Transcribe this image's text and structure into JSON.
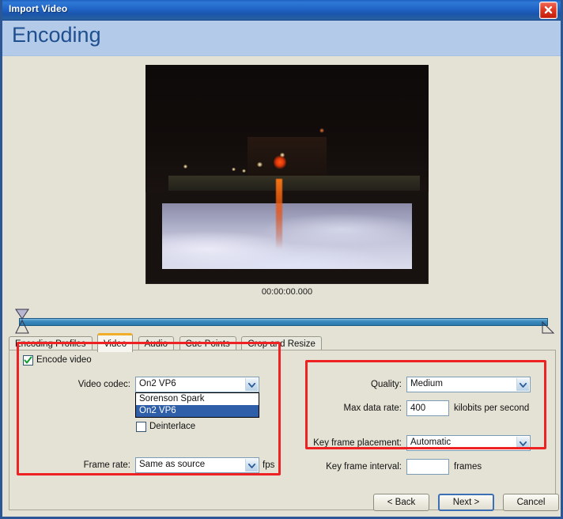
{
  "window": {
    "title": "Import Video",
    "close_icon": "close-x-icon",
    "page_title": "Encoding",
    "accent_blue": "#2b5797",
    "header_blue": "#b3cbe8",
    "highlight_red": "#ee2222"
  },
  "preview": {
    "timecode": "00:00:00.000",
    "scrub": {
      "in_marker_icon": "in-point-marker-icon",
      "out_marker_icon": "out-point-marker-icon"
    }
  },
  "tabs": [
    {
      "label": "Encoding Profiles",
      "active": false
    },
    {
      "label": "Video",
      "active": true
    },
    {
      "label": "Audio",
      "active": false
    },
    {
      "label": "Cue Points",
      "active": false
    },
    {
      "label": "Crop and Resize",
      "active": false
    }
  ],
  "video_tab": {
    "encode_video": {
      "label": "Encode video",
      "checked": true
    },
    "video_codec": {
      "label": "Video codec:",
      "value": "On2 VP6",
      "expanded": true,
      "options": [
        "Sorenson Spark",
        "On2 VP6"
      ],
      "selected_option": "On2 VP6"
    },
    "deinterlace": {
      "label": "Deinterlace",
      "checked": false
    },
    "frame_rate": {
      "label": "Frame rate:",
      "value": "Same as source",
      "units": "fps"
    },
    "quality": {
      "label": "Quality:",
      "value": "Medium"
    },
    "max_data_rate": {
      "label": "Max data rate:",
      "value": "400",
      "units": "kilobits per second"
    },
    "key_frame_placement": {
      "label": "Key frame placement:",
      "value": "Automatic"
    },
    "key_frame_interval": {
      "label": "Key frame interval:",
      "value": "",
      "units": "frames"
    }
  },
  "footer": {
    "back": "< Back",
    "next": "Next >",
    "cancel": "Cancel"
  }
}
